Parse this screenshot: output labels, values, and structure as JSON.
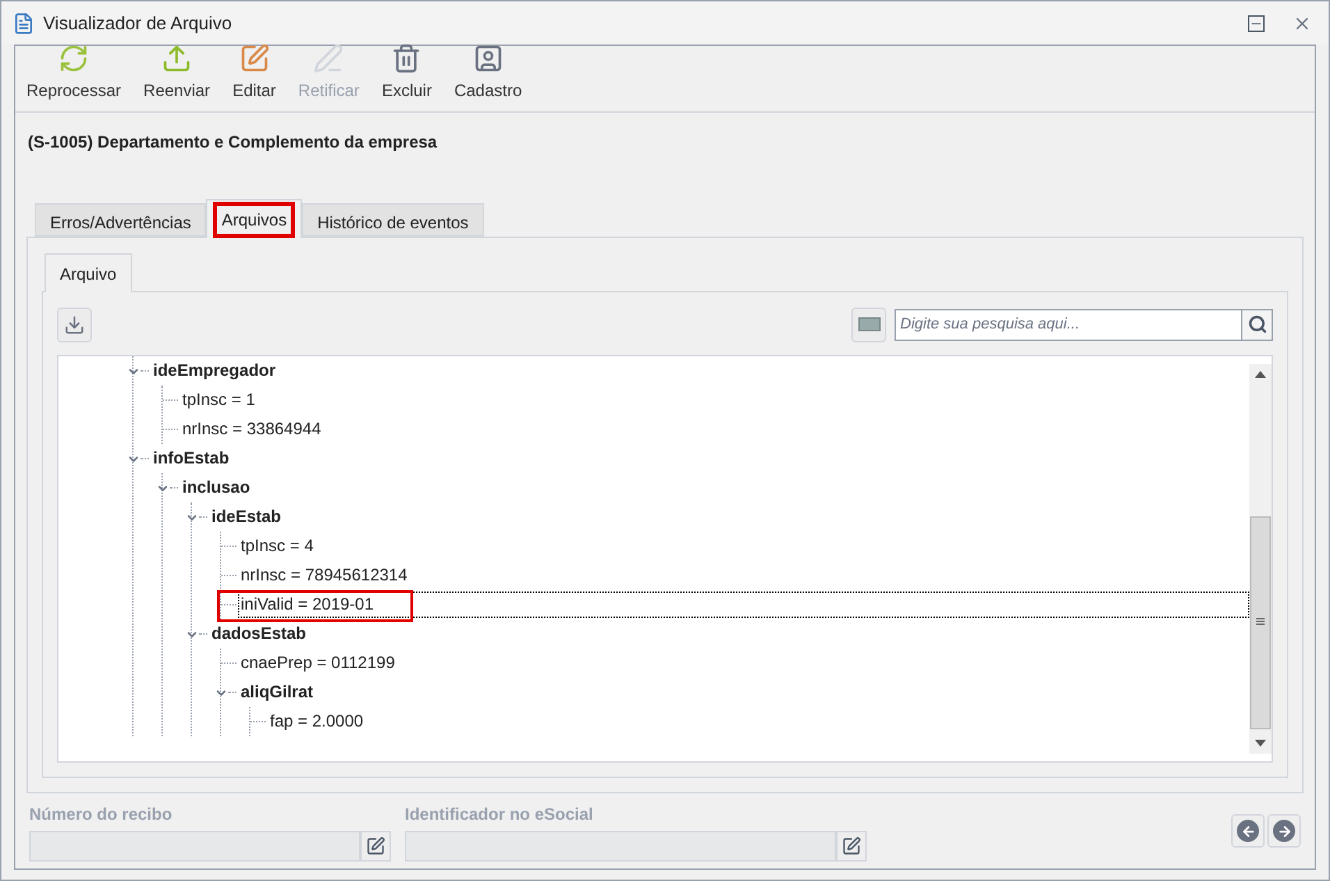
{
  "window": {
    "title": "Visualizador de Arquivo"
  },
  "toolbar": [
    {
      "label": "Reprocessar",
      "kind": "reprocess",
      "disabled": false
    },
    {
      "label": "Reenviar",
      "kind": "resend",
      "disabled": false
    },
    {
      "label": "Editar",
      "kind": "edit",
      "disabled": false
    },
    {
      "label": "Retificar",
      "kind": "rectify",
      "disabled": true
    },
    {
      "label": "Excluir",
      "kind": "delete",
      "disabled": false
    },
    {
      "label": "Cadastro",
      "kind": "register",
      "disabled": false
    }
  ],
  "heading": "(S-1005) Departamento e Complemento da empresa",
  "tabs": [
    {
      "label": "Erros/Advertências",
      "selected": false,
      "annotated": false
    },
    {
      "label": "Arquivos",
      "selected": true,
      "annotated": true
    },
    {
      "label": "Histórico de eventos",
      "selected": false,
      "annotated": false
    }
  ],
  "subtabs": [
    {
      "label": "Arquivo",
      "selected": true
    }
  ],
  "search": {
    "placeholder": "Digite sua pesquisa aqui..."
  },
  "tree": [
    {
      "label": "ideEmpregador",
      "expanded": true,
      "children": [
        {
          "label": "tpInsc = 1"
        },
        {
          "label": "nrInsc = 33864944"
        }
      ]
    },
    {
      "label": "infoEstab",
      "expanded": true,
      "children": [
        {
          "label": "inclusao",
          "expanded": true,
          "children": [
            {
              "label": "ideEstab",
              "expanded": true,
              "children": [
                {
                  "label": "tpInsc = 4"
                },
                {
                  "label": "nrInsc = 78945612314"
                },
                {
                  "label": "iniValid = 2019-01",
                  "selected": true,
                  "annotated": true
                }
              ]
            },
            {
              "label": "dadosEstab",
              "expanded": true,
              "children": [
                {
                  "label": "cnaePrep = 0112199"
                },
                {
                  "label": "aliqGilrat",
                  "expanded": true,
                  "children": [
                    {
                      "label": "fap = 2.0000"
                    }
                  ]
                }
              ]
            }
          ]
        }
      ]
    }
  ],
  "footer": {
    "fields": [
      {
        "label": "Número do recibo",
        "disabled": true
      },
      {
        "label": "Identificador no eSocial",
        "disabled": true
      }
    ]
  }
}
